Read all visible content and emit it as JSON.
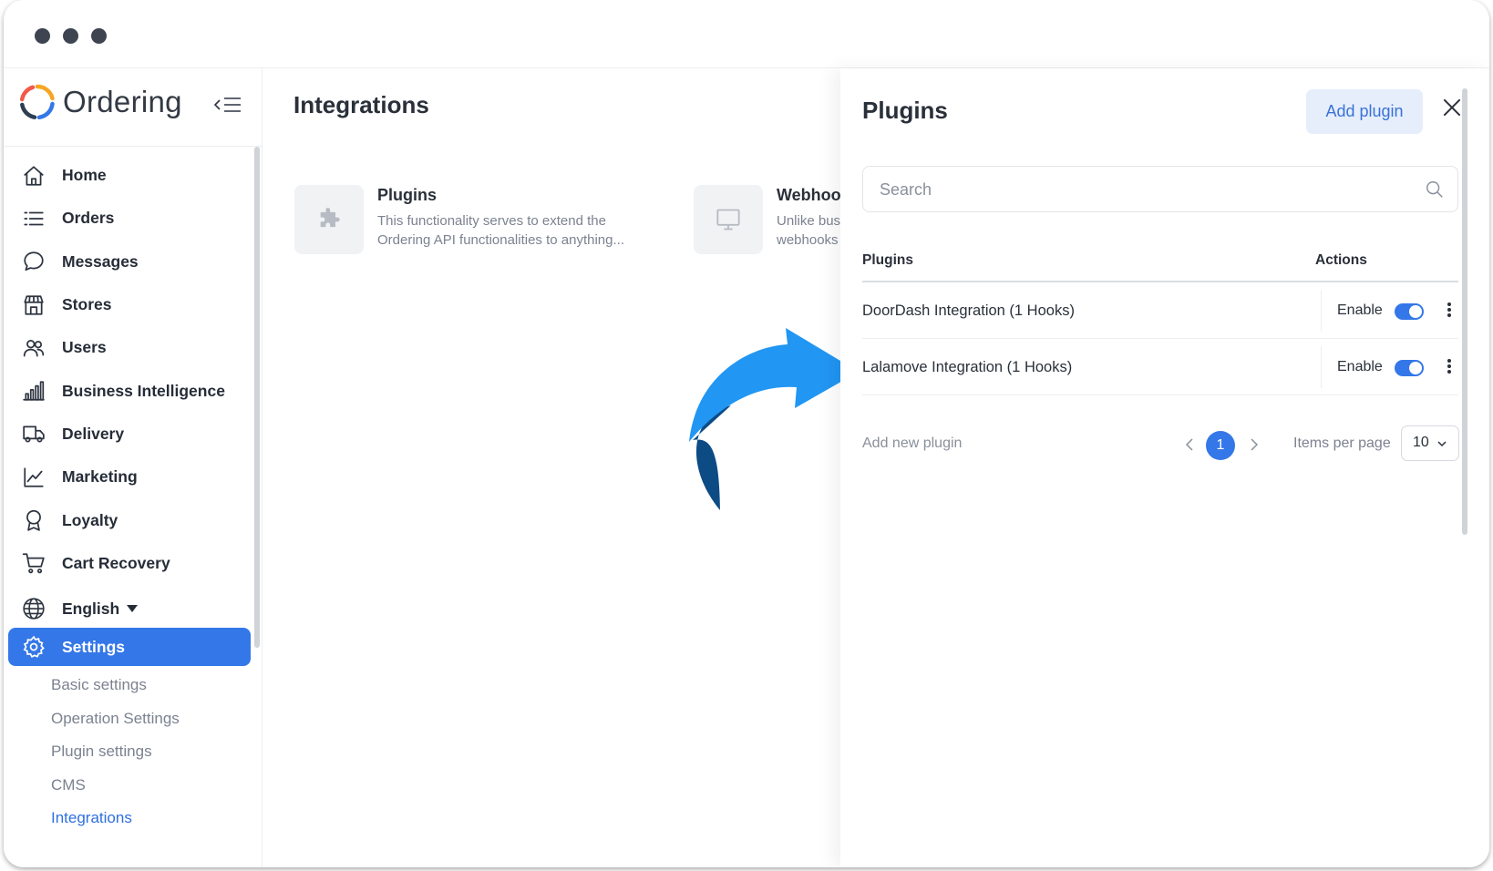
{
  "app": {
    "brand": "Ordering",
    "accent_color": "#3477e8",
    "logo_colors": [
      "#f15a4a",
      "#f5a623",
      "#3477e8",
      "#2c3e50"
    ]
  },
  "sidebar": {
    "items": [
      {
        "label": "Home",
        "icon": "home-icon"
      },
      {
        "label": "Orders",
        "icon": "list-icon"
      },
      {
        "label": "Messages",
        "icon": "chat-bubble-icon"
      },
      {
        "label": "Stores",
        "icon": "storefront-icon"
      },
      {
        "label": "Users",
        "icon": "users-icon"
      },
      {
        "label": "Business Intelligence",
        "icon": "bar-chart-icon"
      },
      {
        "label": "Delivery",
        "icon": "truck-icon"
      },
      {
        "label": "Marketing",
        "icon": "line-chart-icon"
      },
      {
        "label": "Loyalty",
        "icon": "award-icon"
      },
      {
        "label": "Cart Recovery",
        "icon": "cart-icon"
      }
    ],
    "language": "English",
    "settings": {
      "label": "Settings",
      "subitems": [
        "Basic settings",
        "Operation Settings",
        "Plugin settings",
        "CMS",
        "Integrations"
      ],
      "active_subitem": "Integrations"
    }
  },
  "main": {
    "title": "Integrations",
    "cards": [
      {
        "title": "Plugins",
        "description": "This functionality serves to extend the Ordering API functionalities to anything...",
        "icon": "puzzle-icon"
      },
      {
        "title": "Webhoo",
        "description": "Unlike bus webhooks",
        "icon": "monitor-icon"
      }
    ]
  },
  "panel": {
    "title": "Plugins",
    "add_button": "Add plugin",
    "search_placeholder": "Search",
    "columns": {
      "plugins": "Plugins",
      "actions": "Actions"
    },
    "rows": [
      {
        "name": "DoorDash Integration (1 Hooks)",
        "enable_label": "Enable",
        "enabled": true
      },
      {
        "name": "Lalamove Integration (1 Hooks)",
        "enable_label": "Enable",
        "enabled": true
      }
    ],
    "add_new": "Add new plugin",
    "pagination": {
      "current_page": "1",
      "items_per_page_label": "Items per page",
      "items_per_page": "10"
    }
  },
  "annotation": {
    "arrow_color": "#2196f3",
    "arrow_shadow_color": "#0d4b85"
  }
}
